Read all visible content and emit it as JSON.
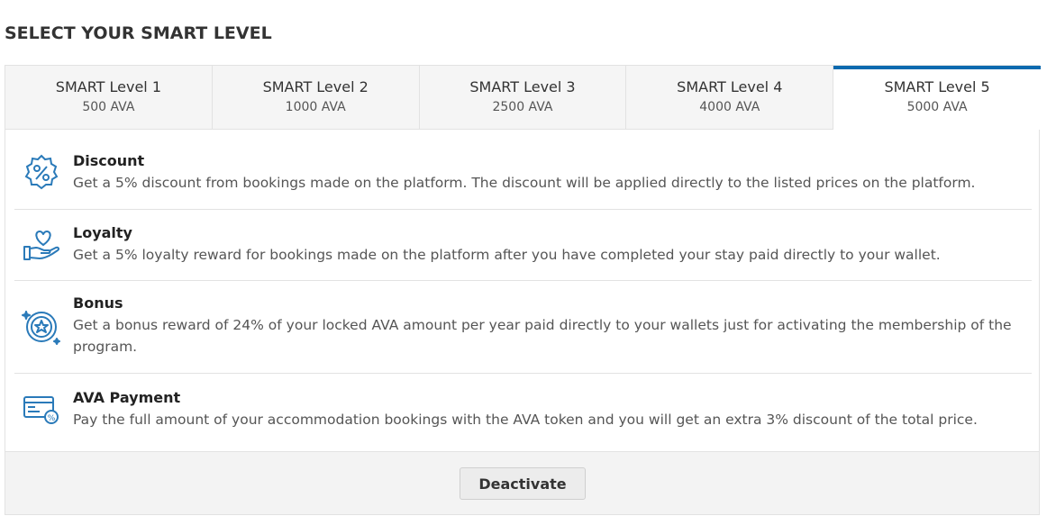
{
  "page": {
    "title": "SELECT YOUR SMART LEVEL"
  },
  "tabs": [
    {
      "name": "SMART Level 1",
      "price": "500 AVA",
      "active": false
    },
    {
      "name": "SMART Level 2",
      "price": "1000 AVA",
      "active": false
    },
    {
      "name": "SMART Level 3",
      "price": "2500 AVA",
      "active": false
    },
    {
      "name": "SMART Level 4",
      "price": "4000 AVA",
      "active": false
    },
    {
      "name": "SMART Level 5",
      "price": "5000 AVA",
      "active": true
    }
  ],
  "features": [
    {
      "icon": "discount-badge-icon",
      "title": "Discount",
      "description": "Get a 5% discount from bookings made on the platform. The discount will be applied directly to the listed prices on the platform."
    },
    {
      "icon": "heart-hand-icon",
      "title": "Loyalty",
      "description": "Get a 5% loyalty reward for bookings made on the platform after you have completed your stay paid directly to your wallet."
    },
    {
      "icon": "star-coin-icon",
      "title": "Bonus",
      "description": "Get a bonus reward of 24% of your locked AVA amount per year paid directly to your wallets just for activating the membership of the program."
    },
    {
      "icon": "card-percent-icon",
      "title": "AVA Payment",
      "description": "Pay the full amount of your accommodation bookings with the AVA token and you will get an extra 3% discount of the total price."
    }
  ],
  "footer": {
    "deactivate_label": "Deactivate"
  },
  "colors": {
    "accent": "#0b6aaf",
    "icon": "#2a7ab9"
  }
}
